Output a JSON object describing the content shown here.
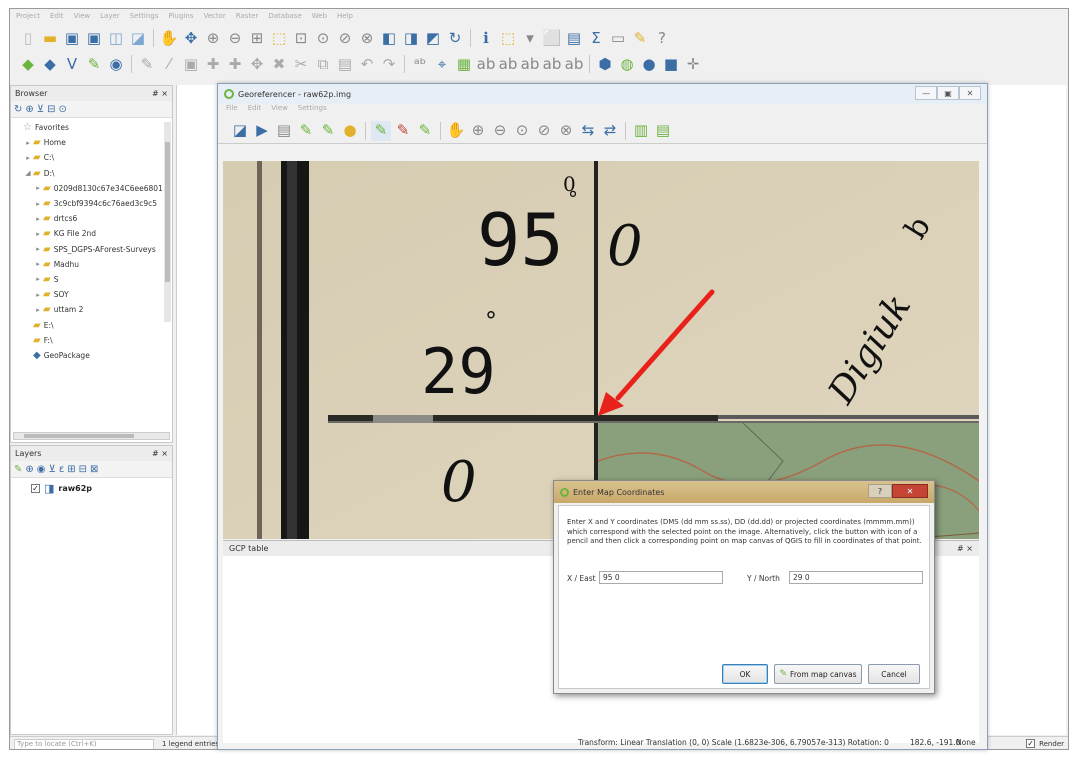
{
  "main_menu": [
    "Project",
    "Edit",
    "View",
    "Layer",
    "Settings",
    "Plugins",
    "Vector",
    "Raster",
    "Database",
    "Web",
    "Help"
  ],
  "browser_panel": {
    "title": "Browser",
    "close": "# ×",
    "items": [
      {
        "label": "Favorites",
        "indent": 0,
        "expander": ""
      },
      {
        "label": "Home",
        "indent": 1,
        "expander": "▸"
      },
      {
        "label": "C:\\",
        "indent": 1,
        "expander": "▸"
      },
      {
        "label": "D:\\",
        "indent": 1,
        "expander": "◢"
      },
      {
        "label": "0209d8130c67e34C6ee6801",
        "indent": 2,
        "expander": "▸"
      },
      {
        "label": "3c9cbf9394c6c76aed3c9c5",
        "indent": 2,
        "expander": "▸"
      },
      {
        "label": "drtcs6",
        "indent": 2,
        "expander": "▸"
      },
      {
        "label": "KG File 2nd",
        "indent": 2,
        "expander": "▸"
      },
      {
        "label": "SPS_DGPS-AForest-Surveys",
        "indent": 2,
        "expander": "▸"
      },
      {
        "label": "Madhu",
        "indent": 2,
        "expander": "▸"
      },
      {
        "label": "S",
        "indent": 2,
        "expander": "▸"
      },
      {
        "label": "SOY",
        "indent": 2,
        "expander": "▸"
      },
      {
        "label": "uttam 2",
        "indent": 2,
        "expander": "▸"
      },
      {
        "label": "E:\\",
        "indent": 1,
        "expander": ""
      },
      {
        "label": "F:\\",
        "indent": 1,
        "expander": ""
      },
      {
        "label": "GeoPackage",
        "indent": 1,
        "expander": ""
      }
    ]
  },
  "layers_panel": {
    "title": "Layers",
    "close": "# ×",
    "layer_name": "raw62p",
    "checked": "✓"
  },
  "status_bar": {
    "locator_placeholder": "Type to locate (Ctrl+K)",
    "legend_text": "1 legend entries",
    "render_label": "Render"
  },
  "georeferencer": {
    "title": "Georeferencer - raw62p.img",
    "menu": [
      "File",
      "Edit",
      "View",
      "Settings"
    ],
    "window_controls": [
      "—",
      "▣",
      "✕"
    ],
    "gcp_table_title": "GCP table",
    "gcp_close": "# ×",
    "status_transform": "Transform: Linear Translation (0, 0) Scale (1.6823e-306, 6.79057e-313) Rotation: 0",
    "status_coords": "182.6, -191.0",
    "status_crs": "None"
  },
  "scan_map": {
    "labels": [
      "95",
      "0",
      "29",
      "0",
      "0",
      "Digiuk",
      "b"
    ]
  },
  "dialog": {
    "title": "Enter Map Coordinates",
    "help": "?",
    "close": "✕",
    "instructions": "Enter X and Y coordinates (DMS (dd mm ss.ss), DD (dd.dd) or projected coordinates (mmmm.mm)) which correspond with the selected point on the image. Alternatively, click the button with icon of a pencil and then click a corresponding point on map canvas of QGIS to fill in coordinates of that point.",
    "x_label": "X / East",
    "x_value": "95 0",
    "y_label": "Y / North",
    "y_value": "29 0",
    "ok": "OK",
    "from_canvas": "From map canvas",
    "cancel": "Cancel"
  },
  "colors": {
    "annotation_arrow": "#e8211b",
    "paper": "#ddd2b8",
    "dialog_close": "#c44536"
  }
}
